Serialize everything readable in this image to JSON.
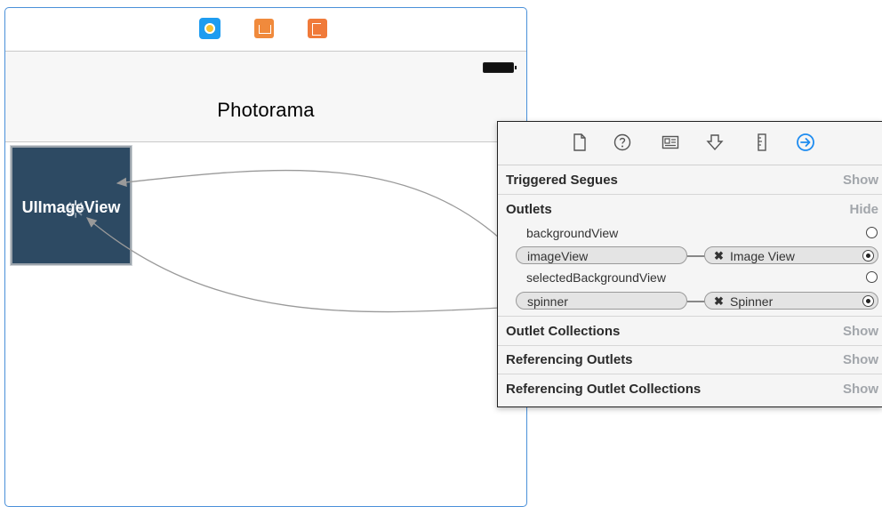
{
  "scene": {
    "nav_title": "Photorama",
    "image_view_label": "UIImageView",
    "dock_icons": [
      "view-controller-icon",
      "first-responder-icon",
      "exit-icon"
    ],
    "status_icon": "battery-icon"
  },
  "inspector": {
    "toolbar_icons": [
      "file-icon",
      "help-icon",
      "identity-icon",
      "attributes-icon",
      "size-icon",
      "connections-icon"
    ],
    "selected_toolbar_icon": "connections-icon",
    "accent_color": "#1e8cf0",
    "sections": {
      "triggered_segues": {
        "title": "Triggered Segues",
        "toggle": "Show"
      },
      "outlets": {
        "title": "Outlets",
        "toggle": "Hide"
      },
      "outlet_collections": {
        "title": "Outlet Collections",
        "toggle": "Show"
      },
      "referencing_outlets": {
        "title": "Referencing Outlets",
        "toggle": "Show"
      },
      "referencing_outlet_collections": {
        "title": "Referencing Outlet Collections",
        "toggle": "Show"
      }
    },
    "outlets": [
      {
        "name": "backgroundView",
        "connected": false,
        "target": ""
      },
      {
        "name": "imageView",
        "connected": true,
        "target": "Image View"
      },
      {
        "name": "selectedBackgroundView",
        "connected": false,
        "target": ""
      },
      {
        "name": "spinner",
        "connected": true,
        "target": "Spinner"
      }
    ]
  }
}
